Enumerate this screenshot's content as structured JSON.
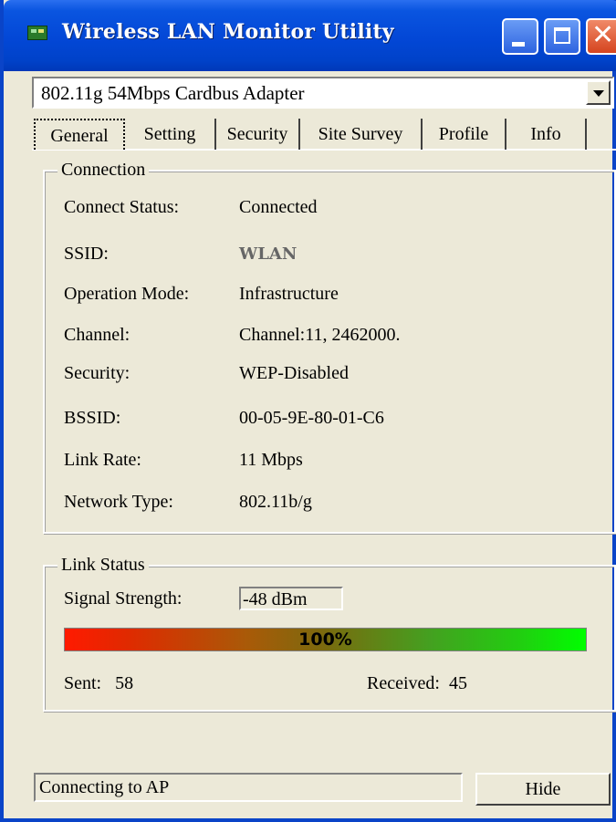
{
  "window": {
    "title": "Wireless LAN Monitor Utility",
    "title_icon": "wireless-network-icon",
    "title_color": "#0a55e0",
    "controls": [
      "minimize",
      "maximize",
      "close"
    ]
  },
  "adapter": {
    "selected": "802.11g 54Mbps Cardbus Adapter"
  },
  "tabs": [
    {
      "label": "General",
      "active": true
    },
    {
      "label": "Setting"
    },
    {
      "label": "Security"
    },
    {
      "label": "Site Survey"
    },
    {
      "label": "Profile"
    },
    {
      "label": "Info"
    }
  ],
  "connection": {
    "title": "Connection",
    "rows": [
      {
        "label": "Connect Status:",
        "value": "Connected"
      },
      {
        "label": "SSID:",
        "value": "WLAN"
      },
      {
        "label": "Operation Mode:",
        "value": "Infrastructure"
      },
      {
        "label": "Channel:",
        "value": "Channel:11, 2462000."
      },
      {
        "label": "Security:",
        "value": "WEP-Disabled"
      },
      {
        "label": "BSSID:",
        "value": "00-05-9E-80-01-C6"
      },
      {
        "label": "Link Rate:",
        "value": "11 Mbps"
      },
      {
        "label": "Network Type:",
        "value": "802.11b/g"
      }
    ]
  },
  "link_status": {
    "title": "Link Status",
    "signal_label": "Signal Strength:",
    "signal_value": "-48 dBm",
    "strength_text": "100%",
    "strength_fraction": 1.0,
    "sent_label": "Sent:",
    "sent_value": "58",
    "received_label": "Received:",
    "received_value": "45"
  },
  "status_bar": {
    "text": "Connecting to AP"
  },
  "buttons": {
    "hide": "Hide"
  }
}
